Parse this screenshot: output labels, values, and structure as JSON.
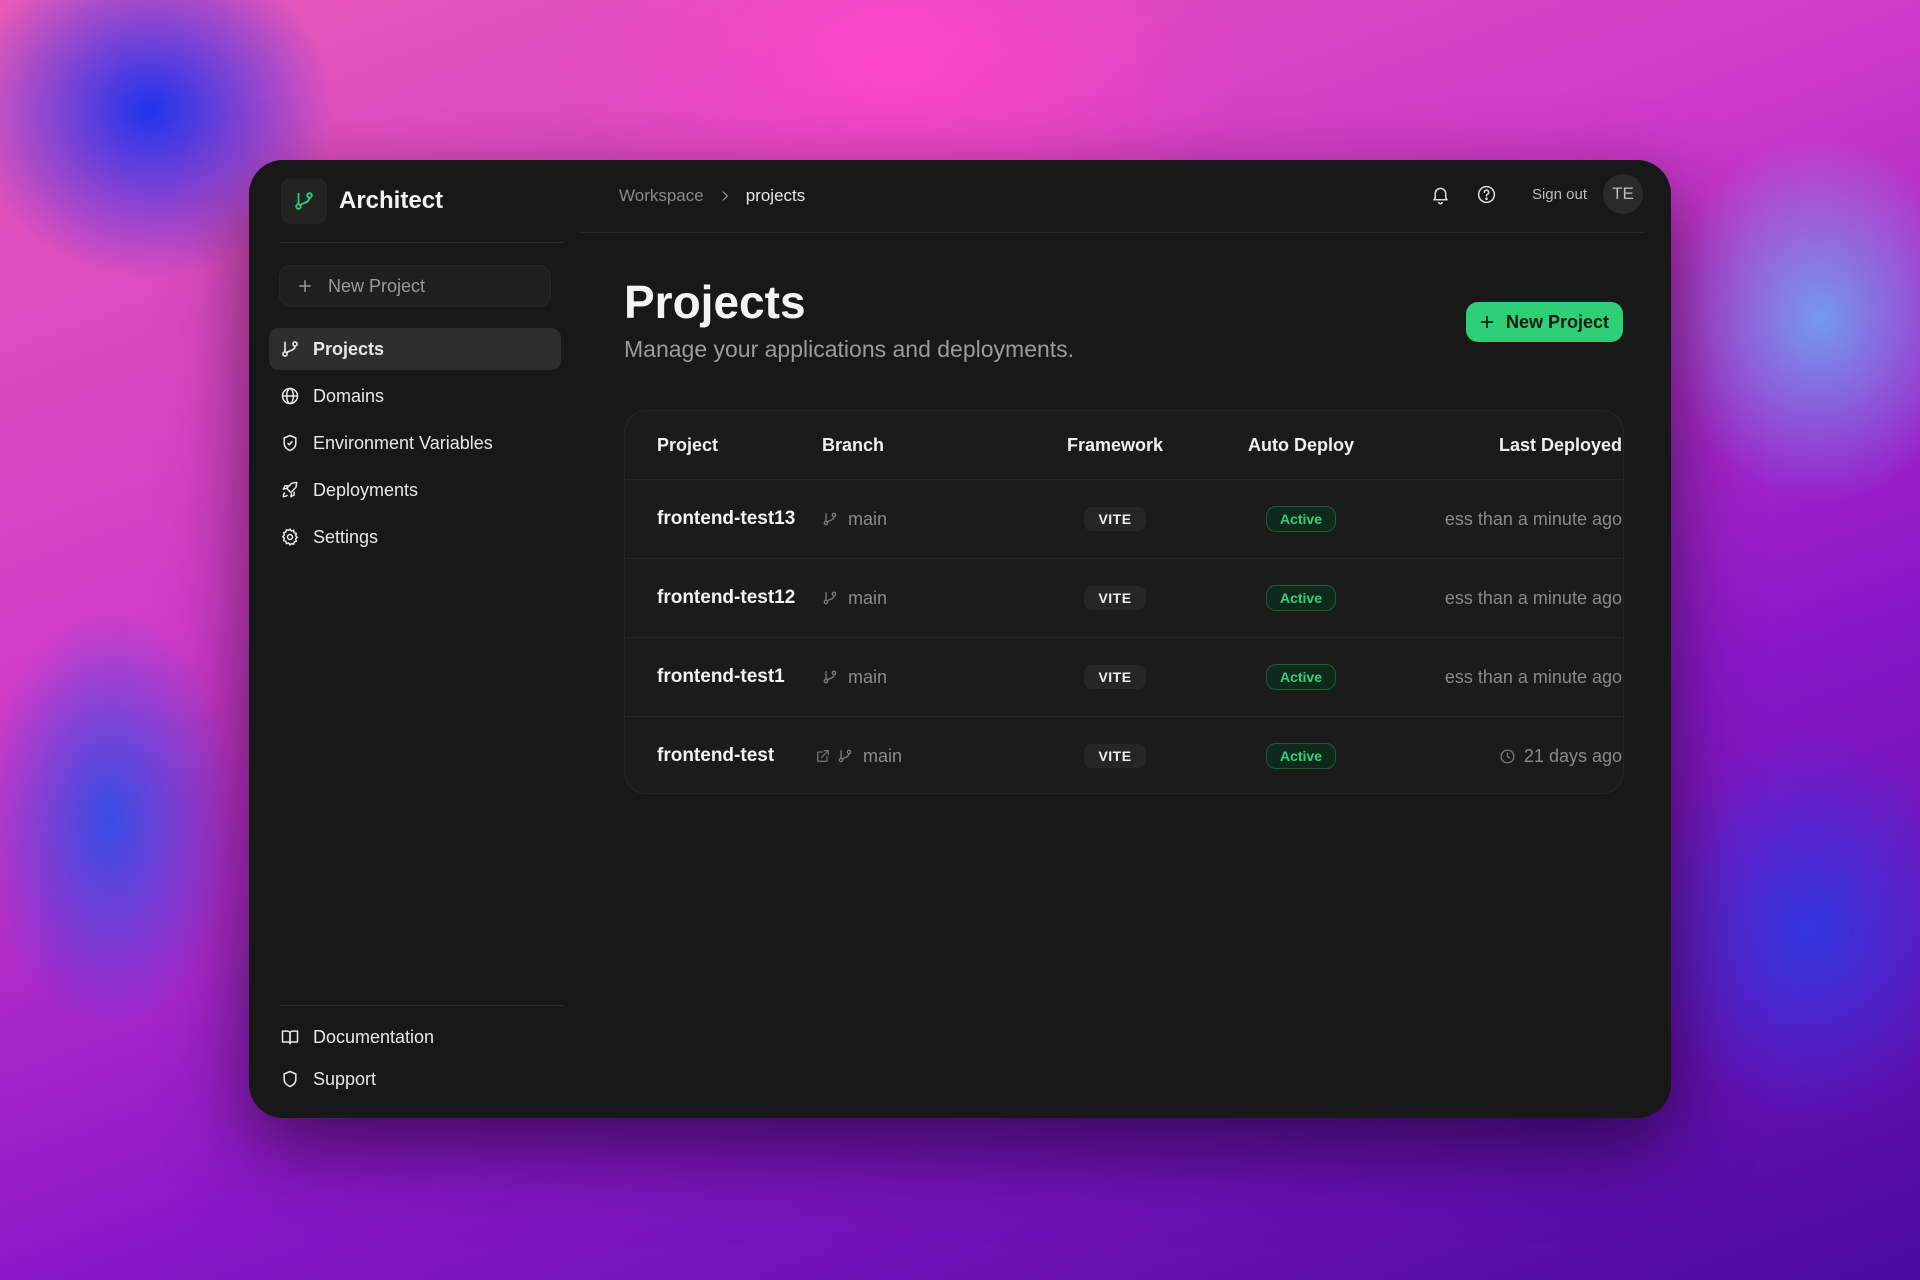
{
  "app": {
    "name": "Architect"
  },
  "sidebar": {
    "new_project_label": "New Project",
    "items": [
      {
        "label": "Projects",
        "icon": "git-branch-icon",
        "active": true
      },
      {
        "label": "Domains",
        "icon": "globe-icon"
      },
      {
        "label": "Environment Variables",
        "icon": "shield-check-icon"
      },
      {
        "label": "Deployments",
        "icon": "rocket-icon"
      },
      {
        "label": "Settings",
        "icon": "gear-icon"
      }
    ],
    "footer_items": [
      {
        "label": "Documentation",
        "icon": "book-icon"
      },
      {
        "label": "Support",
        "icon": "shield-icon"
      }
    ]
  },
  "topbar": {
    "breadcrumb": {
      "root": "Workspace",
      "current": "projects"
    },
    "sign_out_label": "Sign out",
    "avatar_initials": "TE"
  },
  "main": {
    "title": "Projects",
    "subtitle": "Manage your applications and deployments.",
    "new_project_label": "New Project",
    "accent_color": "#2dd077"
  },
  "table": {
    "headers": {
      "project": "Project",
      "branch": "Branch",
      "framework": "Framework",
      "auto_deploy": "Auto Deploy",
      "last_deployed": "Last Deployed"
    },
    "rows": [
      {
        "project": "frontend-test13",
        "branch": "main",
        "framework": "VITE",
        "status": "Active",
        "last": "ess than a minute ago"
      },
      {
        "project": "frontend-test12",
        "branch": "main",
        "framework": "VITE",
        "status": "Active",
        "last": "ess than a minute ago"
      },
      {
        "project": "frontend-test1",
        "branch": "main",
        "framework": "VITE",
        "status": "Active",
        "last": "ess than a minute ago"
      },
      {
        "project": "frontend-test",
        "branch": "main",
        "framework": "VITE",
        "status": "Active",
        "last": "21 days ago"
      }
    ]
  }
}
